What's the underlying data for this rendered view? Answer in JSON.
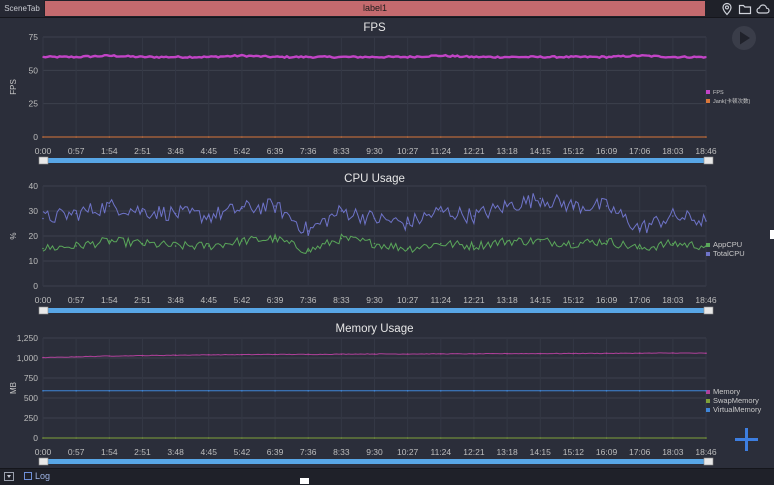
{
  "toolbar": {
    "scene_tab": "SceneTab",
    "label": "label1",
    "icons": [
      "location-icon",
      "folder-icon",
      "cloud-icon"
    ]
  },
  "footer": {
    "log_label": "Log"
  },
  "colors": {
    "background": "#2b2e3a",
    "fps": "#c244c6",
    "jank": "#d9773a",
    "app_cpu": "#5aa65a",
    "total_cpu": "#6e73c8",
    "memory": "#b0409a",
    "swap_memory": "#7fa13a",
    "virtual_memory": "#3f86d8",
    "slider": "#58a6e6"
  },
  "chart_data": [
    {
      "type": "line",
      "title": "FPS",
      "ylabel": "FPS",
      "ylim": [
        0,
        75
      ],
      "yticks": [
        "75",
        "50",
        "25",
        "0"
      ],
      "xticks": [
        "0:00",
        "0:57",
        "1:54",
        "2:51",
        "3:48",
        "4:45",
        "5:42",
        "6:39",
        "7:36",
        "8:33",
        "9:30",
        "10:27",
        "11:24",
        "12:21",
        "13:18",
        "14:15",
        "15:12",
        "16:09",
        "17:06",
        "18:03",
        "18:46"
      ],
      "series": [
        {
          "name": "FPS",
          "values": [
            60,
            60,
            61,
            60,
            60,
            60,
            61,
            60,
            60,
            60,
            60,
            60,
            61,
            60,
            60,
            60,
            60,
            60,
            61,
            60,
            60
          ]
        },
        {
          "name": "Jank(卡顿次数)",
          "values": [
            0,
            0,
            0,
            0,
            0,
            0,
            0,
            0,
            0,
            0,
            0,
            0,
            0,
            0,
            0,
            0,
            0,
            0,
            0,
            0,
            0
          ]
        }
      ],
      "legend": "right"
    },
    {
      "type": "line",
      "title": "CPU Usage",
      "ylabel": "%",
      "ylim": [
        0,
        40
      ],
      "yticks": [
        "40",
        "30",
        "20",
        "10",
        "0"
      ],
      "xticks": [
        "0:00",
        "0:57",
        "1:54",
        "2:51",
        "3:48",
        "4:45",
        "5:42",
        "6:39",
        "7:36",
        "8:33",
        "9:30",
        "10:27",
        "11:24",
        "12:21",
        "13:18",
        "14:15",
        "15:12",
        "16:09",
        "17:06",
        "18:03",
        "18:46"
      ],
      "series": [
        {
          "name": "AppCPU",
          "values": [
            15,
            16,
            18,
            17,
            16,
            16,
            18,
            19,
            14,
            19,
            17,
            15,
            17,
            16,
            18,
            18,
            17,
            18,
            15,
            17,
            16
          ]
        },
        {
          "name": "TotalCPU",
          "values": [
            27,
            29,
            32,
            30,
            29,
            28,
            31,
            32,
            22,
            30,
            27,
            25,
            30,
            28,
            32,
            35,
            32,
            32,
            23,
            28,
            26
          ]
        }
      ],
      "legend": "right"
    },
    {
      "type": "line",
      "title": "Memory Usage",
      "ylabel": "MB",
      "ylim": [
        0,
        1250
      ],
      "yticks": [
        "1,250",
        "1,000",
        "750",
        "500",
        "250",
        "0"
      ],
      "xticks": [
        "0:00",
        "0:57",
        "1:54",
        "2:51",
        "3:48",
        "4:45",
        "5:42",
        "6:39",
        "7:36",
        "8:33",
        "9:30",
        "10:27",
        "11:24",
        "12:21",
        "13:18",
        "14:15",
        "15:12",
        "16:09",
        "17:06",
        "18:03",
        "18:46"
      ],
      "series": [
        {
          "name": "Memory",
          "values": [
            1005,
            1015,
            1025,
            1030,
            1035,
            1040,
            1042,
            1045,
            1045,
            1048,
            1050,
            1050,
            1052,
            1052,
            1055,
            1055,
            1057,
            1058,
            1060,
            1062,
            1060
          ]
        },
        {
          "name": "SwapMemory",
          "values": [
            0,
            0,
            0,
            0,
            0,
            0,
            0,
            0,
            0,
            0,
            0,
            0,
            0,
            0,
            0,
            0,
            0,
            0,
            0,
            0,
            0
          ]
        },
        {
          "name": "VirtualMemory",
          "values": [
            590,
            590,
            590,
            590,
            590,
            590,
            590,
            590,
            590,
            590,
            590,
            590,
            590,
            590,
            590,
            590,
            590,
            590,
            590,
            590,
            590
          ]
        }
      ],
      "legend": "right"
    }
  ]
}
